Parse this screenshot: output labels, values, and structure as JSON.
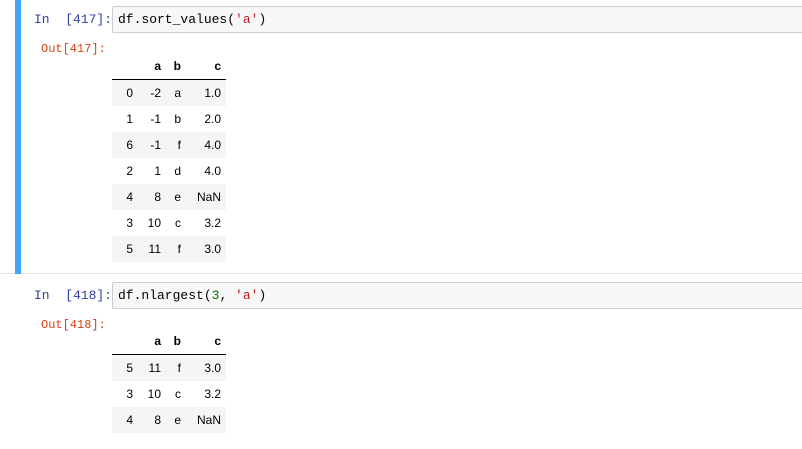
{
  "cells": [
    {
      "in_prompt": "In  [417]:",
      "code": {
        "prefix": "df.sort_values(",
        "string": "'a'",
        "suffix": ")"
      },
      "out_prompt": "Out[417]:",
      "table": {
        "columns": [
          "",
          "a",
          "b",
          "c"
        ],
        "rows": [
          [
            "0",
            "-2",
            "a",
            "1.0"
          ],
          [
            "1",
            "-1",
            "b",
            "2.0"
          ],
          [
            "6",
            "-1",
            "f",
            "4.0"
          ],
          [
            "2",
            "1",
            "d",
            "4.0"
          ],
          [
            "4",
            "8",
            "e",
            "NaN"
          ],
          [
            "3",
            "10",
            "c",
            "3.2"
          ],
          [
            "5",
            "11",
            "f",
            "3.0"
          ]
        ]
      },
      "selected": true,
      "selection_color": "#42a5f5"
    },
    {
      "in_prompt": "In  [418]:",
      "code": {
        "prefix": "df.nlargest(",
        "number": "3",
        "sep": ", ",
        "string": "'a'",
        "suffix": ")"
      },
      "out_prompt": "Out[418]:",
      "table": {
        "columns": [
          "",
          "a",
          "b",
          "c"
        ],
        "rows": [
          [
            "5",
            "11",
            "f",
            "3.0"
          ],
          [
            "3",
            "10",
            "c",
            "3.2"
          ],
          [
            "4",
            "8",
            "e",
            "NaN"
          ]
        ]
      },
      "selected": false
    }
  ]
}
